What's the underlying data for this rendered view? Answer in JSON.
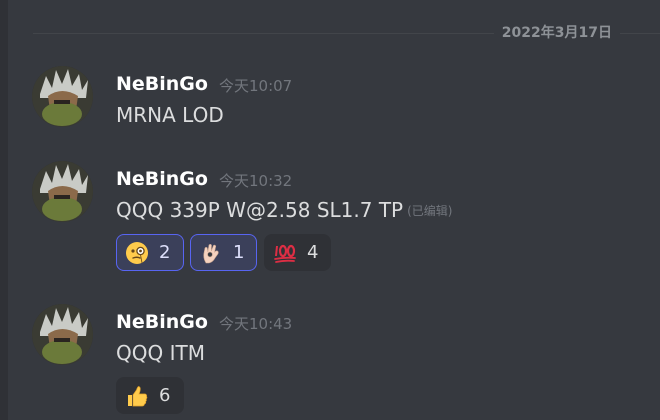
{
  "date_divider": "2022年3月17日",
  "messages": [
    {
      "author": "NeBinGo",
      "timestamp": "今天10:07",
      "content": "MRNA LOD",
      "edited": "",
      "reactions": []
    },
    {
      "author": "NeBinGo",
      "timestamp": "今天10:32",
      "content": "QQQ 339P W@2.58 SL1.7 TP",
      "edited": "(已编辑)",
      "reactions": [
        {
          "emoji": "face-with-monocle-icon",
          "count": "2",
          "me": true
        },
        {
          "emoji": "ok-hand-icon",
          "count": "1",
          "me": true
        },
        {
          "emoji": "hundred-points-icon",
          "count": "4",
          "me": false
        }
      ]
    },
    {
      "author": "NeBinGo",
      "timestamp": "今天10:43",
      "content": "QQQ ITM",
      "edited": "",
      "reactions": [
        {
          "emoji": "thumbs-up-icon",
          "count": "6",
          "me": false
        }
      ]
    }
  ],
  "colors": {
    "background": "#36393f",
    "author": "#ffffff",
    "timestamp": "#72767d",
    "text": "#dcddde",
    "reaction_active_border": "#5865f2",
    "reaction_active_bg": "#3b405a",
    "reaction_bg": "#2f3136"
  }
}
